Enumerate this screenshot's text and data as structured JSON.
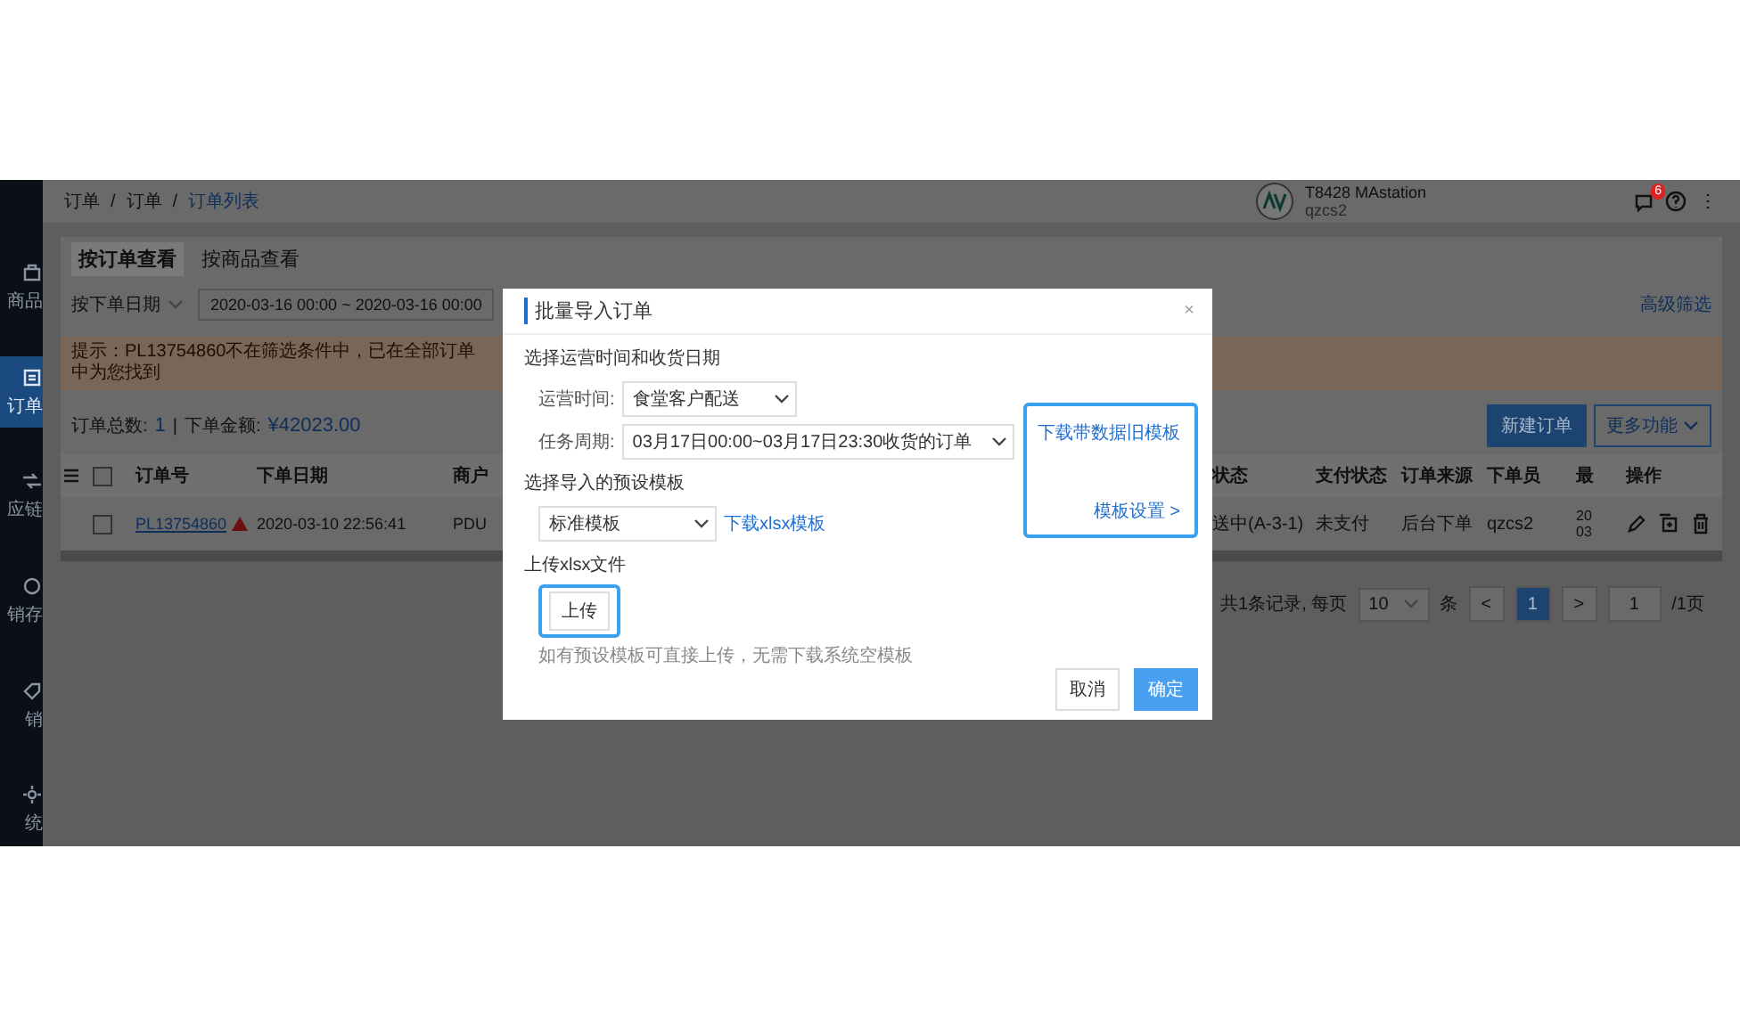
{
  "sidebar": {
    "items": [
      {
        "label": "商品",
        "selected": false
      },
      {
        "label": "订单",
        "selected": true
      },
      {
        "label": "应链",
        "selected": false
      },
      {
        "label": "销存",
        "selected": false
      },
      {
        "label": "销",
        "selected": false
      },
      {
        "label": "统",
        "selected": false
      }
    ]
  },
  "header": {
    "breadcrumb": [
      "订单",
      "订单",
      "订单列表"
    ],
    "separators": [
      "/",
      "/"
    ],
    "station": "T8428 MAstation",
    "user": "qzcs2",
    "badge": "6"
  },
  "tabs": [
    {
      "label": "按订单查看",
      "selected": true
    },
    {
      "label": "按商品查看",
      "selected": false
    }
  ],
  "filter": {
    "date_type": "按下单日期",
    "date_range": "2020-03-16 00:00 ~ 2020-03-16 00:00",
    "advanced": "高级筛选"
  },
  "notice": "提示：PL13754860不在筛选条件中，已在全部订单中为您找到",
  "summary": {
    "count_label": "订单总数:",
    "count": "1",
    "divider": "|",
    "amount_label": "下单金额:",
    "amount": "¥42023.00"
  },
  "actions": [
    "新建订单",
    "更多功能"
  ],
  "table": {
    "select_all_checked": false,
    "columns_left": [
      "订单号",
      "下单日期",
      "商户"
    ],
    "columns_right": [
      "状态",
      "支付状态",
      "订单来源",
      "下单员",
      "最",
      "操作"
    ],
    "rows": [
      {
        "checked": false,
        "order_no": "PL13754860",
        "date": "2020-03-10 22:56:41",
        "merchant": "PDU",
        "status": "送中(A-3-1)",
        "pay": "未支付",
        "source": "后台下单",
        "operator": "qzcs2",
        "last": "20\n03"
      }
    ]
  },
  "pagination": {
    "total": "共1条记录, 每页",
    "page_size": "10",
    "unit": "条",
    "prev": "<",
    "pages": [
      {
        "label": "1",
        "selected": true
      }
    ],
    "next": ">",
    "jump": "1",
    "page_count": "/1页"
  },
  "dialog": {
    "title": "批量导入订单",
    "close": "×",
    "section1": "选择运营时间和收货日期",
    "fields": [
      {
        "label": "运营时间:",
        "value": "食堂客户配送"
      },
      {
        "label": "任务周期:",
        "value": "03月17日00:00~03月17日23:30收货的订单"
      }
    ],
    "side_links": [
      "下载带数据旧模板",
      "模板设置 >"
    ],
    "section2": "选择导入的预设模板",
    "template": "标准模板",
    "template_link": "下载xlsx模板",
    "section3": "上传xlsx文件",
    "upload": "上传",
    "hint": "如有预设模板可直接上传，无需下载系统空模板",
    "buttons": [
      {
        "label": "取消",
        "kind": "secondary"
      },
      {
        "label": "确定",
        "kind": "primary"
      }
    ]
  }
}
